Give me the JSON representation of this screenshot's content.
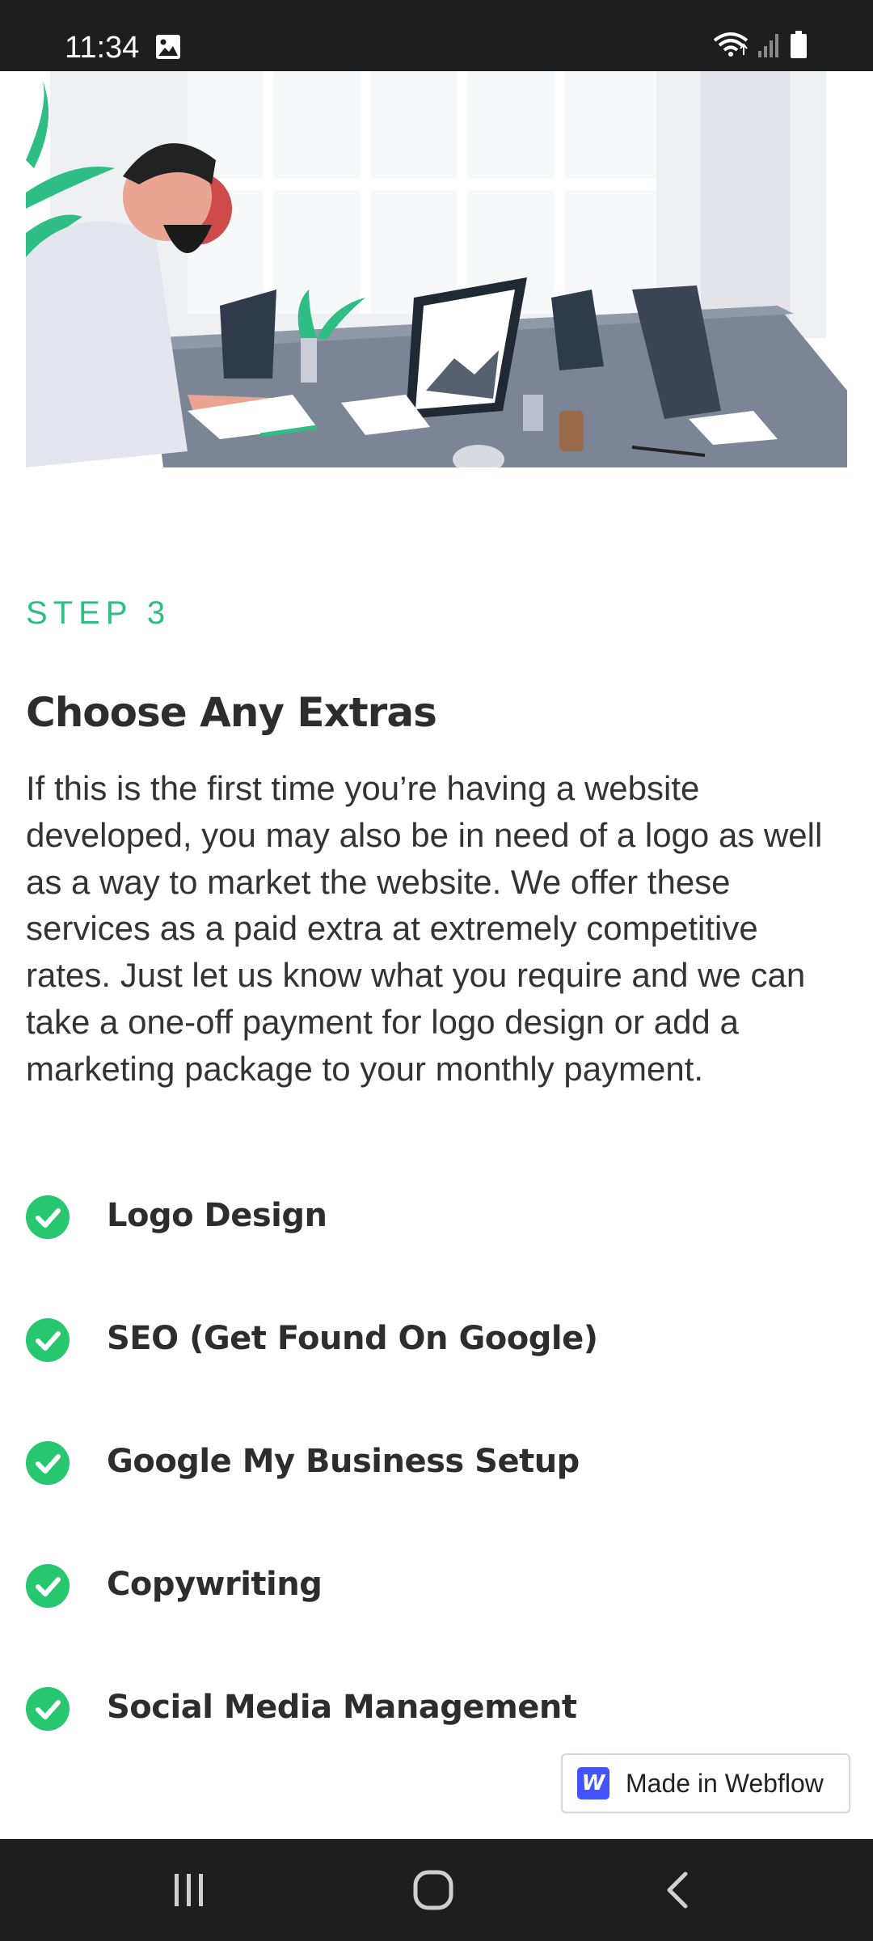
{
  "status_bar": {
    "time": "11:34",
    "icons": [
      "gallery-icon",
      "wifi-icon",
      "signal-icon",
      "battery-icon"
    ]
  },
  "hero": {
    "icon": "office-illustration"
  },
  "section": {
    "step_label": "STEP 3",
    "title": "Choose Any Extras",
    "description": "If this is the first time you’re having a website developed, you may also be in need of a logo as well as a way to market the website. We offer these services as a paid extra at extremely competitive rates. Just let us know what you require and we can take a one-off payment for logo design or add a marketing package to your monthly payment."
  },
  "extras": {
    "items": [
      {
        "label": "Logo Design"
      },
      {
        "label": "SEO (Get Found On Google)"
      },
      {
        "label": "Google My Business Setup"
      },
      {
        "label": "Copywriting"
      },
      {
        "label": "Social Media Management"
      }
    ]
  },
  "badge": {
    "logo_letter": "W",
    "label": "Made in Webflow"
  },
  "nav_bar": {
    "buttons": [
      "recent-apps-icon",
      "home-icon",
      "back-icon"
    ]
  },
  "colors": {
    "accent": "#2ebd85",
    "check": "#27c76f",
    "heading": "#2d2d2d",
    "body_text": "#333333",
    "system_bar": "#1e1e1f",
    "webflow_blue": "#4353ff"
  }
}
